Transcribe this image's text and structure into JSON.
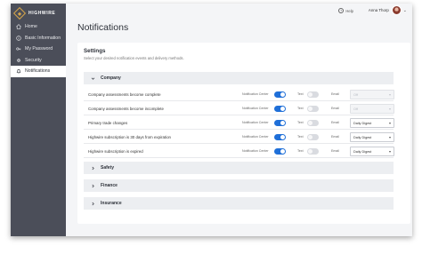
{
  "brand": {
    "name": "HIGHWIRE"
  },
  "sidebar": {
    "items": [
      {
        "label": "Home",
        "icon": "home-icon",
        "active": false
      },
      {
        "label": "Basic Information",
        "icon": "info-icon",
        "active": false
      },
      {
        "label": "My Password",
        "icon": "key-icon",
        "active": false
      },
      {
        "label": "Security",
        "icon": "gear-icon",
        "active": false
      },
      {
        "label": "Notifications",
        "icon": "bell-icon",
        "active": true
      }
    ]
  },
  "topbar": {
    "help_label": "Help",
    "user_name": "Anna Thorp"
  },
  "page": {
    "title": "Notifications"
  },
  "settings": {
    "title": "Settings",
    "subtitle": "Select your desired notification events and delivery methods.",
    "column_labels": {
      "center": "Notification Center",
      "text": "Text",
      "email": "Email"
    },
    "sections": [
      {
        "name": "Company",
        "expanded": true
      },
      {
        "name": "Safety",
        "expanded": false
      },
      {
        "name": "Finance",
        "expanded": false
      },
      {
        "name": "Insurance",
        "expanded": false
      }
    ],
    "rows": [
      {
        "label": "Company assessments become complete",
        "center": true,
        "text": false,
        "email": "Off",
        "email_enabled": false
      },
      {
        "label": "Company assessments become incomplete",
        "center": true,
        "text": false,
        "email": "Off",
        "email_enabled": false
      },
      {
        "label": "Primary trade changes",
        "center": true,
        "text": false,
        "email": "Daily Digest",
        "email_enabled": true
      },
      {
        "label": "Highwire subscription is 30 days from expiration",
        "center": true,
        "text": false,
        "email": "Daily Digest",
        "email_enabled": true
      },
      {
        "label": "Highwire subscription is expired",
        "center": true,
        "text": false,
        "email": "Daily Digest",
        "email_enabled": true
      }
    ]
  },
  "colors": {
    "sidebar": "#4b4e59",
    "accent": "#1f6fd8",
    "brand": "#d7a64b"
  }
}
